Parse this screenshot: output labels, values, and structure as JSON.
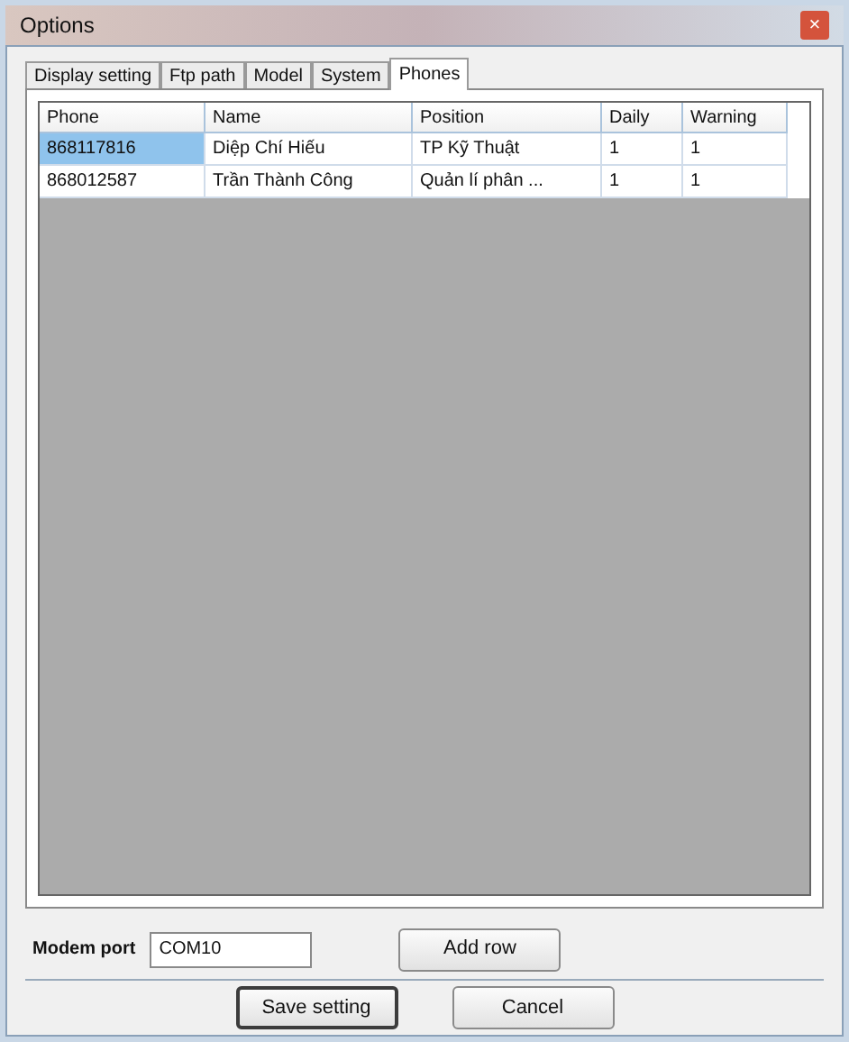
{
  "window": {
    "title": "Options",
    "close": "×"
  },
  "tabs": [
    {
      "label": "Display setting",
      "selected": false
    },
    {
      "label": "Ftp path",
      "selected": false
    },
    {
      "label": "Model",
      "selected": false
    },
    {
      "label": "System",
      "selected": false
    },
    {
      "label": "Phones",
      "selected": true
    }
  ],
  "table": {
    "columns": [
      "Phone",
      "Name",
      "Position",
      "Daily",
      "Warning"
    ],
    "rows": [
      {
        "selected": true,
        "cells": [
          "868117816",
          "Diệp Chí Hiếu",
          "TP Kỹ Thuật",
          "1",
          "1"
        ]
      },
      {
        "selected": false,
        "cells": [
          "868012587",
          "Trần Thành Công",
          "Quản lí phân ...",
          "1",
          "1"
        ]
      }
    ]
  },
  "modem_port": {
    "label": "Modem port",
    "value": "COM10"
  },
  "buttons": [
    {
      "label": "Add row",
      "kind": "row"
    },
    {
      "label": "Save setting",
      "kind": "save"
    },
    {
      "label": "Cancel",
      "kind": "cancel"
    }
  ]
}
